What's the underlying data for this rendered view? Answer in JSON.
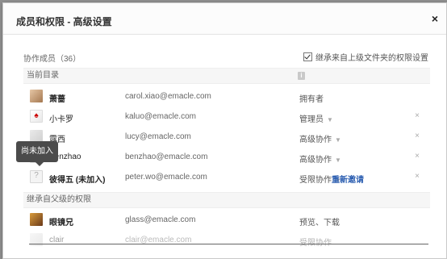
{
  "dialog": {
    "title": "成员和权限 - 高级设置",
    "close_icon": "×"
  },
  "members": {
    "count_label": "协作成员（36）",
    "inherit_label": "继承来自上级文件夹的权限设置",
    "inherit_checked": true
  },
  "sections": {
    "current_dir": "当前目录",
    "inherited": "继承自父级的权限"
  },
  "current_rows": [
    {
      "name": "萧蔷",
      "email": "carol.xiao@emacle.com",
      "permission": "拥有者",
      "has_dropdown": false,
      "remove_icon": ""
    },
    {
      "name": "小卡罗",
      "email": "kaluo@emacle.com",
      "permission": "管理员",
      "has_dropdown": true,
      "remove_icon": "×"
    },
    {
      "name": "露西",
      "email": "lucy@emacle.com",
      "permission": "高级协作",
      "has_dropdown": true,
      "remove_icon": "×"
    },
    {
      "name": "Benzhao",
      "email": "benzhao@emacle.com",
      "permission": "高级协作",
      "has_dropdown": true,
      "remove_icon": "×"
    },
    {
      "name": "彼得五 (未加入)",
      "email": "peter.wo@emacle.com",
      "permission": "受限协作",
      "has_dropdown": true,
      "remove_icon": "×",
      "reinvite": "重新邀请"
    }
  ],
  "inherited_rows": [
    {
      "name": "眼镜兄",
      "email": "glass@emacle.com",
      "permission": "预览、下载"
    },
    {
      "name": "clair",
      "email": "clair@emacle.com",
      "permission": "受限协作"
    }
  ],
  "tooltip": "尚未加入",
  "caret_icon": "▼",
  "info_icon": "i"
}
